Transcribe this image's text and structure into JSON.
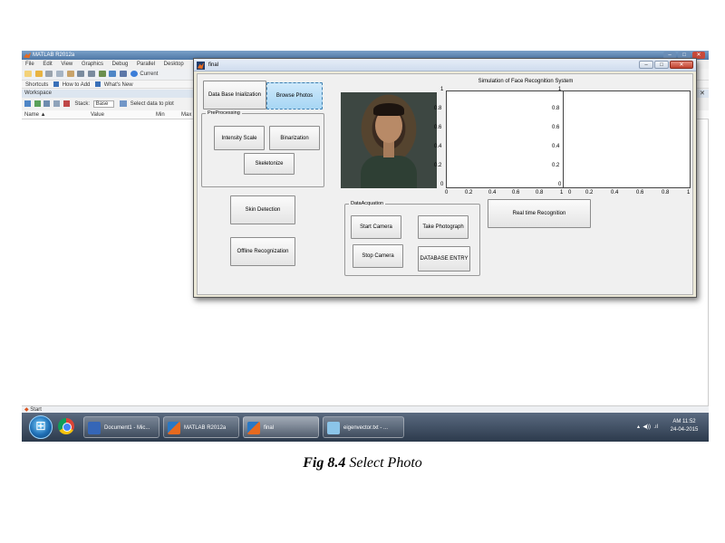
{
  "matlab": {
    "title": "MATLAB R2012a",
    "menu": [
      "File",
      "Edit",
      "View",
      "Graphics",
      "Debug",
      "Parallel",
      "Desktop"
    ],
    "current_label": "Current",
    "shortcuts": [
      "Shortcuts",
      "How to Add",
      "What's New"
    ],
    "workspace_label": "Workspace",
    "stack_label": "Stack:",
    "stack_value": "Base",
    "select_data": "Select data to plot",
    "columns": [
      "Name ▲",
      "Value",
      "Min",
      "Max"
    ],
    "start_label": "Start"
  },
  "figure": {
    "title": "final",
    "buttons": {
      "db_init": "Data Base Inialization",
      "browse": "Browse Photos",
      "intensity": "Intensity Scale",
      "binarization": "Binarization",
      "skeletonize": "Skeletonize",
      "skin": "Skin Detection",
      "offline": "Offline Recognization",
      "start_camera": "Start Camera",
      "take_photo": "Take Photograph",
      "stop_camera": "Stop Camera",
      "db_entry": "DATABASE ENTRY",
      "realtime": "Real time Recognition"
    },
    "panels": {
      "preprocessing": "PreProcessing",
      "acquisition": "DataAcquation"
    },
    "plot_title": "Simulation of Face Recognition System",
    "axes1_y_ticks": [
      "1",
      "0.8",
      "0.6",
      "0.4",
      "0.2",
      "0"
    ],
    "axes1_x_ticks": [
      "0",
      "0.2",
      "0.4",
      "0.6",
      "0.8",
      "1"
    ],
    "axes2_y_ticks": [
      "1",
      "0.8",
      "0.6",
      "0.4",
      "0.2",
      "0"
    ],
    "axes2_x_ticks": [
      "0",
      "0.2",
      "0.4",
      "0.6",
      "0.8",
      "1"
    ]
  },
  "taskbar": {
    "items": [
      "Document1 - Mic...",
      "MATLAB R2012a",
      "final",
      "eigenvector.txt - ..."
    ],
    "time": "AM 11:52",
    "date": "24-04-2015"
  },
  "caption": {
    "label": "Fig 8.4",
    "text": "Select Photo"
  }
}
